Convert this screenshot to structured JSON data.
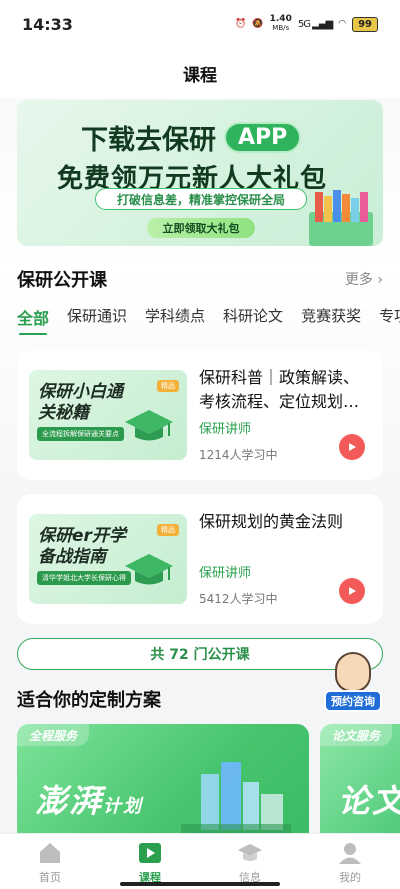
{
  "status": {
    "time": "14:33",
    "net_speed_top": "1.40",
    "net_speed_unit": "MB/s",
    "signal_label": "5G",
    "battery": "99"
  },
  "header": {
    "title": "课程"
  },
  "banner": {
    "line1": "下载去保研",
    "app_label": "APP",
    "line2": "免费领万元新人大礼包",
    "line3": "打破信息差，精准掌控保研全局",
    "button": "立即领取大礼包"
  },
  "public_courses": {
    "title": "保研公开课",
    "more": "更多 ›",
    "tabs": [
      "全部",
      "保研通识",
      "学科绩点",
      "科研论文",
      "竞赛获奖",
      "专项提"
    ],
    "courses": [
      {
        "thumb_title": "保研小白通关秘籍",
        "thumb_tag": "全流程拆解保研通关要点",
        "thumb_badge": "精品",
        "title": "保研科普｜政策解读、考核流程、定位规划…",
        "teacher": "保研讲师",
        "learners": "1214人学习中"
      },
      {
        "thumb_title": "保研er开学备战指南",
        "thumb_tag": "清华学姐北大学长保研心得",
        "thumb_badge": "精品",
        "title": "保研规划的黄金法则",
        "teacher": "保研讲师",
        "learners": "5412人学习中"
      }
    ],
    "total_button": "共 72 门公开课"
  },
  "consult": {
    "label": "预约咨询"
  },
  "plans": {
    "title": "适合你的定制方案",
    "items": [
      {
        "tag": "全程服务",
        "name": "澎湃",
        "sub": "计划"
      },
      {
        "tag": "论文服务",
        "name": "论文",
        "sub": ""
      }
    ]
  },
  "tabbar": {
    "items": [
      {
        "label": "首页",
        "icon": "home-icon"
      },
      {
        "label": "课程",
        "icon": "course-play-icon"
      },
      {
        "label": "信息",
        "icon": "graduation-cap-icon"
      },
      {
        "label": "我的",
        "icon": "profile-icon"
      }
    ]
  },
  "colors": {
    "accent": "#2aa04e",
    "play": "#f25a5a",
    "consult": "#1f6dd7"
  }
}
